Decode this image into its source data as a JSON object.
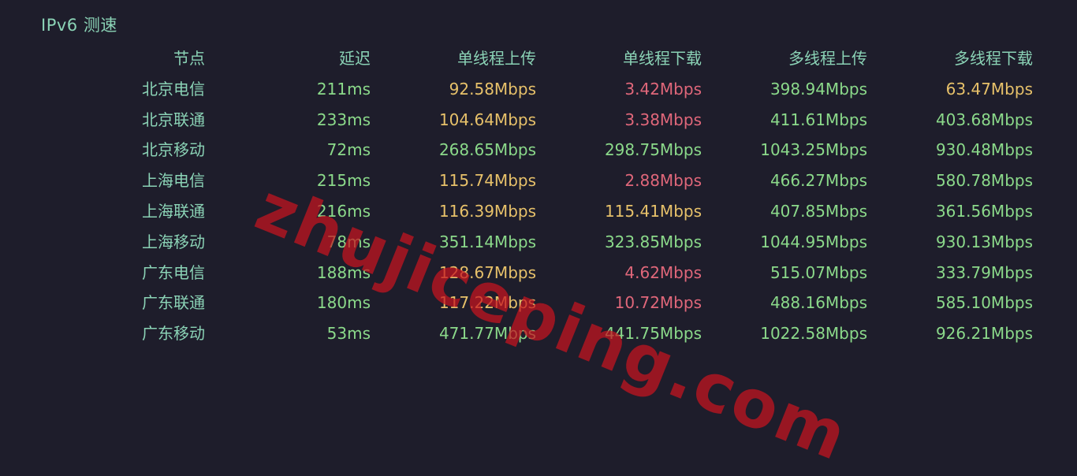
{
  "title": "IPv6 测速",
  "colors": {
    "background": "#1e1d2b",
    "label": "#8bd3b6",
    "good": "#8bd98a",
    "medium": "#e7c16a",
    "bad": "#e0677a",
    "watermark": "#c8141e"
  },
  "table": {
    "headers": [
      "节点",
      "延迟",
      "单线程上传",
      "单线程下载",
      "多线程上传",
      "多线程下载"
    ],
    "rows": [
      {
        "node": "北京电信",
        "latency": "211ms",
        "st_up": "92.58Mbps",
        "st_down": "3.42Mbps",
        "mt_up": "398.94Mbps",
        "mt_down": "63.47Mbps"
      },
      {
        "node": "北京联通",
        "latency": "233ms",
        "st_up": "104.64Mbps",
        "st_down": "3.38Mbps",
        "mt_up": "411.61Mbps",
        "mt_down": "403.68Mbps"
      },
      {
        "node": "北京移动",
        "latency": "72ms",
        "st_up": "268.65Mbps",
        "st_down": "298.75Mbps",
        "mt_up": "1043.25Mbps",
        "mt_down": "930.48Mbps"
      },
      {
        "node": "上海电信",
        "latency": "215ms",
        "st_up": "115.74Mbps",
        "st_down": "2.88Mbps",
        "mt_up": "466.27Mbps",
        "mt_down": "580.78Mbps"
      },
      {
        "node": "上海联通",
        "latency": "216ms",
        "st_up": "116.39Mbps",
        "st_down": "115.41Mbps",
        "mt_up": "407.85Mbps",
        "mt_down": "361.56Mbps"
      },
      {
        "node": "上海移动",
        "latency": "78ms",
        "st_up": "351.14Mbps",
        "st_down": "323.85Mbps",
        "mt_up": "1044.95Mbps",
        "mt_down": "930.13Mbps"
      },
      {
        "node": "广东电信",
        "latency": "188ms",
        "st_up": "128.67Mbps",
        "st_down": "4.62Mbps",
        "mt_up": "515.07Mbps",
        "mt_down": "333.79Mbps"
      },
      {
        "node": "广东联通",
        "latency": "180ms",
        "st_up": "117.22Mbps",
        "st_down": "10.72Mbps",
        "mt_up": "488.16Mbps",
        "mt_down": "585.10Mbps"
      },
      {
        "node": "广东移动",
        "latency": "53ms",
        "st_up": "471.77Mbps",
        "st_down": "441.75Mbps",
        "mt_up": "1022.58Mbps",
        "mt_down": "926.21Mbps"
      }
    ],
    "row_colors": [
      {
        "latency": "green",
        "st_up": "yellow",
        "st_down": "red",
        "mt_up": "green",
        "mt_down": "yellow"
      },
      {
        "latency": "green",
        "st_up": "yellow",
        "st_down": "red",
        "mt_up": "green",
        "mt_down": "green"
      },
      {
        "latency": "green",
        "st_up": "green",
        "st_down": "green",
        "mt_up": "green",
        "mt_down": "green"
      },
      {
        "latency": "green",
        "st_up": "yellow",
        "st_down": "red",
        "mt_up": "green",
        "mt_down": "green"
      },
      {
        "latency": "green",
        "st_up": "yellow",
        "st_down": "yellow",
        "mt_up": "green",
        "mt_down": "green"
      },
      {
        "latency": "green",
        "st_up": "green",
        "st_down": "green",
        "mt_up": "green",
        "mt_down": "green"
      },
      {
        "latency": "green",
        "st_up": "yellow",
        "st_down": "red",
        "mt_up": "green",
        "mt_down": "green"
      },
      {
        "latency": "green",
        "st_up": "yellow",
        "st_down": "red",
        "mt_up": "green",
        "mt_down": "green"
      },
      {
        "latency": "green",
        "st_up": "green",
        "st_down": "green",
        "mt_up": "green",
        "mt_down": "green"
      }
    ]
  },
  "watermark": "zhujiceping.com"
}
